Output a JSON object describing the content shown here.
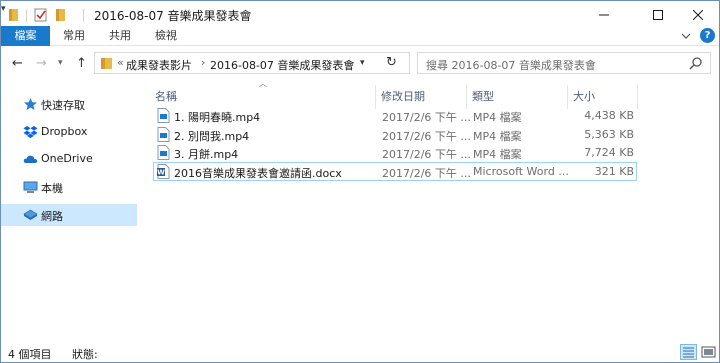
{
  "window": {
    "title": "2016-08-07 音樂成果發表會"
  },
  "ribbon": {
    "tabs": [
      "檔案",
      "常用",
      "共用",
      "檢視"
    ],
    "help": "?"
  },
  "address": {
    "overflow": "«",
    "crumbs": [
      "成果發表影片",
      "2016-08-07 音樂成果發表會"
    ],
    "separator": "›"
  },
  "search": {
    "placeholder": "搜尋 2016-08-07 音樂成果發表會"
  },
  "sidebar": {
    "items": [
      {
        "label": "快速存取",
        "icon": "star-icon"
      },
      {
        "label": "Dropbox",
        "icon": "dropbox-icon"
      },
      {
        "label": "OneDrive",
        "icon": "cloud-icon"
      },
      {
        "label": "本機",
        "icon": "computer-icon"
      },
      {
        "label": "網路",
        "icon": "network-icon",
        "selected": true
      }
    ]
  },
  "columns": {
    "name": "名稱",
    "date": "修改日期",
    "type": "類型",
    "size": "大小"
  },
  "files": [
    {
      "name": "1. 陽明春曉.mp4",
      "date": "2017/2/6 下午 ...",
      "type": "MP4 檔案",
      "size": "4,438 KB",
      "icon": "video-file-icon"
    },
    {
      "name": "2. 別問我.mp4",
      "date": "2017/2/6 下午 ...",
      "type": "MP4 檔案",
      "size": "5,363 KB",
      "icon": "video-file-icon"
    },
    {
      "name": "3. 月餅.mp4",
      "date": "2017/2/6 下午 ...",
      "type": "MP4 檔案",
      "size": "7,724 KB",
      "icon": "video-file-icon"
    },
    {
      "name": "2016音樂成果發表會邀請函.docx",
      "date": "2017/2/6 下午 ...",
      "type": "Microsoft Word ...",
      "size": "321 KB",
      "icon": "word-file-icon",
      "selected": true
    }
  ],
  "status": {
    "count": "4 個項目",
    "state": "狀態:"
  },
  "colors": {
    "accent": "#1979ca",
    "selection": "#cce8ff",
    "selection_border": "#99d1ff",
    "folder": "#e8b84a"
  }
}
